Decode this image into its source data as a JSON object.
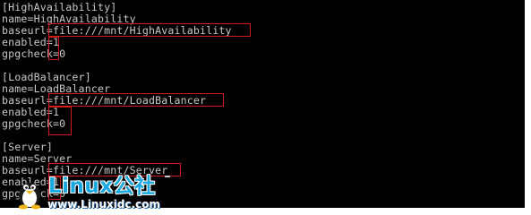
{
  "terminal": {
    "lines": [
      "[HighAvailability]",
      "name=HighAvailability",
      "baseurl=file:///mnt/HighAvailability",
      "enabled=1",
      "gpgcheck=0",
      "",
      "[LoadBalancer]",
      "name=LoadBalancer",
      "baseurl=file:///mnt/LoadBalancer",
      "enabled=1",
      "gpgcheck=0",
      "",
      "[Server]",
      "name=Server",
      "baseurl=file:///mnt/Server",
      "enabled=1",
      "gpgcheck=0"
    ],
    "text_color": "#c8c8c8",
    "background": "#000000",
    "highlight_color": "#d21a1a"
  },
  "watermark": {
    "title": "Linux公社",
    "url": "www.Linuxidc.com",
    "brand_color": "#19a8e0",
    "icon": "tux-penguin-icon"
  }
}
